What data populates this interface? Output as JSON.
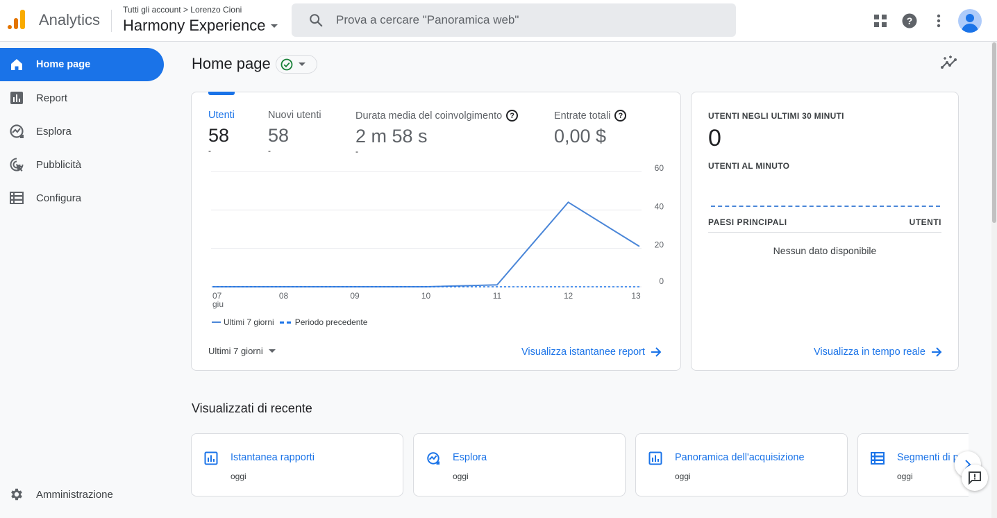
{
  "header": {
    "app_name": "Analytics",
    "breadcrumb": "Tutti gli account > Lorenzo Cioni",
    "property": "Harmony Experience",
    "search_placeholder": "Prova a cercare \"Panoramica web\"",
    "icons": [
      "apps-grid-icon",
      "help-icon",
      "more-vert-icon",
      "account-avatar-icon"
    ]
  },
  "sidebar": {
    "items": [
      {
        "label": "Home page",
        "icon": "home-icon",
        "active": true
      },
      {
        "label": "Report",
        "icon": "bar-chart-icon"
      },
      {
        "label": "Esplora",
        "icon": "explore-trend-icon"
      },
      {
        "label": "Pubblicità",
        "icon": "advertising-target-icon"
      },
      {
        "label": "Configura",
        "icon": "list-config-icon"
      }
    ],
    "admin": {
      "label": "Amministrazione",
      "icon": "gear-icon"
    }
  },
  "page": {
    "title": "Home page",
    "status": "check-ok",
    "accent": "#1a73e8"
  },
  "overview": {
    "metrics": [
      {
        "label": "Utenti",
        "value": "58",
        "delta": "-",
        "active": true
      },
      {
        "label": "Nuovi utenti",
        "value": "58",
        "delta": "-"
      },
      {
        "label": "Durata media del coinvolgimento",
        "value": "2 m 58 s",
        "delta": "-",
        "help": true
      },
      {
        "label": "Entrate totali",
        "value": "0,00 $",
        "help": true
      }
    ],
    "legend": {
      "current": "Ultimi 7 giorni",
      "previous": "Periodo precedente"
    },
    "range": "Ultimi 7 giorni",
    "link": "Visualizza istantanee report"
  },
  "chart_data": {
    "type": "line",
    "title": "",
    "xlabel": "",
    "ylabel": "",
    "categories": [
      "07\ngiu",
      "08",
      "09",
      "10",
      "11",
      "12",
      "13"
    ],
    "x_tick_labels": [
      "07",
      "08",
      "09",
      "10",
      "11",
      "12",
      "13"
    ],
    "x_sub_label": "giu",
    "y_ticks": [
      0,
      20,
      40,
      60
    ],
    "ylim": [
      0,
      60
    ],
    "y_axis_side": "right",
    "grid": true,
    "legend_position": "bottom-left",
    "series": [
      {
        "name": "Ultimi 7 giorni",
        "style": "solid",
        "color": "#4a86d8",
        "values": [
          0,
          0,
          0,
          0,
          1,
          44,
          21
        ]
      },
      {
        "name": "Periodo precedente",
        "style": "dashed",
        "color": "#1a73e8",
        "values": [
          0,
          0,
          0,
          0,
          0,
          0,
          0
        ]
      }
    ]
  },
  "realtime": {
    "title": "UTENTI NEGLI ULTIMI 30 MINUTI",
    "value": "0",
    "per_minute_label": "UTENTI AL MINUTO",
    "col_country": "PAESI PRINCIPALI",
    "col_users": "UTENTI",
    "empty": "Nessun dato disponibile",
    "link": "Visualizza in tempo reale"
  },
  "recent": {
    "title": "Visualizzati di recente",
    "items": [
      {
        "title": "Istantanea rapporti",
        "sub": "oggi",
        "icon": "bar-chart-icon"
      },
      {
        "title": "Esplora",
        "sub": "oggi",
        "icon": "explore-trend-icon"
      },
      {
        "title": "Panoramica dell'acquisizione",
        "sub": "oggi",
        "icon": "bar-chart-icon"
      },
      {
        "title": "Segmenti di p",
        "sub": "oggi",
        "icon": "list-icon"
      }
    ]
  }
}
